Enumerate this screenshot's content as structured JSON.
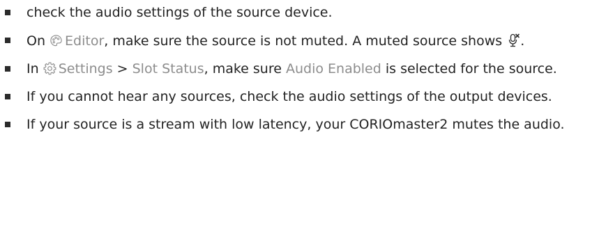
{
  "items": [
    {
      "text": "check the audio settings of the source device."
    },
    {
      "pre": "On ",
      "ui_label": "Editor",
      "mid": ", make sure the source is not muted. A muted source shows ",
      "post": "."
    },
    {
      "pre": "In ",
      "ui_label_1": "Settings",
      "sep": " > ",
      "ui_label_2": "Slot Status",
      "mid": ", make sure ",
      "ui_label_3": "Audio Enabled",
      "post": " is selected for the source."
    },
    {
      "text": "If you cannot hear any sources, check the audio settings of the output devices."
    },
    {
      "text": "If your source is a stream with low latency, your CORIOmaster2 mutes the audio."
    }
  ],
  "icons": {
    "editor": "palette-icon",
    "settings": "gear-icon",
    "muted": "microphone-muted-icon"
  },
  "colors": {
    "text": "#222222",
    "ui_label": "#8c8c8c",
    "bullet": "#2b2b2b"
  }
}
